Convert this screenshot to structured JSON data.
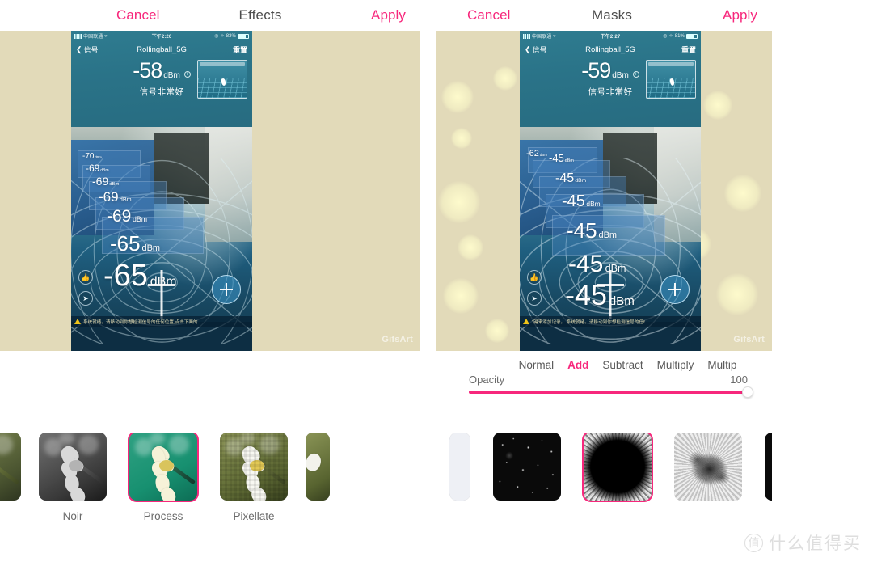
{
  "accent": "#f7277c",
  "canvas_bg": "#e2dab9",
  "left_panel": {
    "nav": {
      "cancel_label": "Cancel",
      "title": "Effects",
      "apply_label": "Apply"
    },
    "artboard": {
      "watermark": "GifsArt",
      "phone": {
        "status_bar": {
          "carrier": "中国联通",
          "wifi_icon": "wifi-icon",
          "time": "下午2:20",
          "battery_percent": "83%",
          "bluetooth_icon": "bluetooth-icon",
          "location_icon": "location-icon"
        },
        "title_bar": {
          "back_label": "信号",
          "app_title": "Rollingball_5G",
          "reset_label": "重置"
        },
        "reading": {
          "value": "-58",
          "unit": "dBm",
          "description": "信号非常好",
          "info_icon": "info-icon"
        },
        "stacked_readings": [
          {
            "value": "-70",
            "unit": "dBm"
          },
          {
            "value": "-69",
            "unit": "dBm"
          },
          {
            "value": "-69",
            "unit": "dBm"
          },
          {
            "value": "-69",
            "unit": "dBm"
          },
          {
            "value": "-69",
            "unit": "dBm"
          },
          {
            "value": "-65",
            "unit": "dBm"
          },
          {
            "value": "-65",
            "unit": "dBm"
          }
        ],
        "warning_text": "系统就绪。请移动到你想检测信号的任何位置,点击下面的",
        "add_button": "plus-icon",
        "side_buttons": [
          "thumb-up-icon",
          "share-icon"
        ]
      }
    },
    "effects": [
      {
        "label": "",
        "style": "partial-left",
        "selected": false
      },
      {
        "label": "Noir",
        "style": "noir",
        "selected": false
      },
      {
        "label": "Process",
        "style": "process",
        "selected": true
      },
      {
        "label": "Pixellate",
        "style": "pixellate",
        "selected": false
      },
      {
        "label": "",
        "style": "partial-right",
        "selected": false
      }
    ]
  },
  "right_panel": {
    "nav": {
      "cancel_label": "Cancel",
      "title": "Masks",
      "apply_label": "Apply"
    },
    "artboard": {
      "watermark": "GifsArt",
      "phone": {
        "status_bar": {
          "carrier": "中国联通",
          "wifi_icon": "wifi-icon",
          "time": "下午2:27",
          "battery_percent": "81%",
          "bluetooth_icon": "bluetooth-icon",
          "location_icon": "location-icon"
        },
        "title_bar": {
          "back_label": "信号",
          "app_title": "Rollingball_5G",
          "reset_label": "重置"
        },
        "reading": {
          "value": "-59",
          "unit": "dBm",
          "description": "信号非常好",
          "info_icon": "info-icon"
        },
        "stacked_readings": [
          {
            "value": "-62",
            "unit": "dBm"
          },
          {
            "value": "-45",
            "unit": "dBm"
          },
          {
            "value": "-45",
            "unit": "dBm"
          },
          {
            "value": "-45",
            "unit": "dBm"
          },
          {
            "value": "-45",
            "unit": "dBm"
          },
          {
            "value": "-45",
            "unit": "dBm"
          },
          {
            "value": "-45",
            "unit": "dBm"
          }
        ],
        "warning_text": "\"键来添加记录。 系统就绪。请移动到你想检测信号的任f",
        "add_button": "plus-icon",
        "side_buttons": [
          "thumb-up-icon",
          "share-icon"
        ]
      }
    },
    "blend_modes": [
      {
        "label": "Normal",
        "selected": false
      },
      {
        "label": "Add",
        "selected": true
      },
      {
        "label": "Subtract",
        "selected": false
      },
      {
        "label": "Multiply",
        "selected": false
      },
      {
        "label": "Multip",
        "selected": false
      }
    ],
    "opacity": {
      "label": "Opacity",
      "value": "100",
      "percent": 100
    },
    "masks": [
      {
        "style": "blank",
        "selected": false
      },
      {
        "style": "stars",
        "selected": false
      },
      {
        "style": "hole",
        "selected": true
      },
      {
        "style": "cloud",
        "selected": false
      },
      {
        "style": "blob",
        "selected": false
      }
    ]
  },
  "page_watermark": {
    "mark": "值",
    "text": "什么值得买"
  }
}
